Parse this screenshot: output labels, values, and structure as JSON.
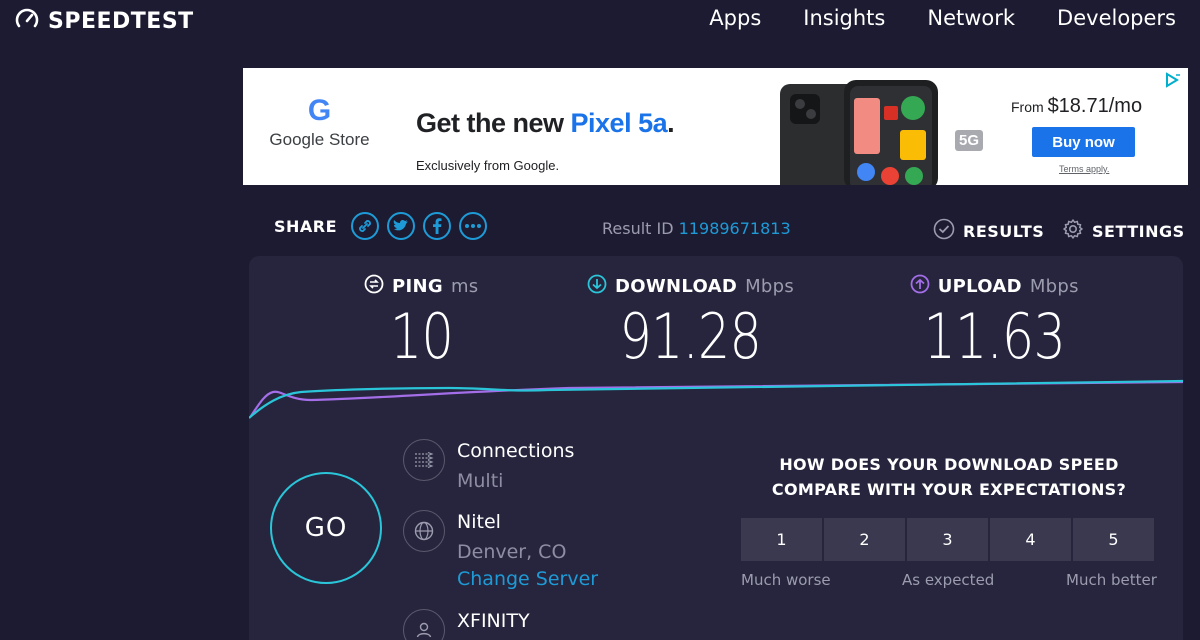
{
  "header": {
    "logo_text": "SPEEDTEST",
    "nav": [
      "Apps",
      "Insights",
      "Network",
      "Developers"
    ]
  },
  "ad": {
    "brand_logo": "G",
    "brand_name": "Google Store",
    "headline_pre": "Get the new ",
    "headline_product": "Pixel 5a",
    "headline_post": ".",
    "subline": "Exclusively from Google.",
    "badge": "5G",
    "price_from": "From ",
    "price": "$18.71/mo",
    "cta": "Buy now",
    "terms": "Terms apply.",
    "colors": {
      "blue": "#1a73e8",
      "gray_badge": "#a8aab0"
    }
  },
  "share": {
    "label": "SHARE",
    "icons": [
      "link-icon",
      "twitter-icon",
      "facebook-icon",
      "more-icon"
    ]
  },
  "result": {
    "label": "Result ID ",
    "id": "11989671813"
  },
  "actions": {
    "results": "RESULTS",
    "settings": "SETTINGS"
  },
  "metrics": {
    "ping": {
      "label": "PING",
      "unit": "ms",
      "value": "10"
    },
    "download": {
      "label": "DOWNLOAD",
      "unit": "Mbps",
      "value": "91.28"
    },
    "upload": {
      "label": "UPLOAD",
      "unit": "Mbps",
      "value": "11.63"
    }
  },
  "go_label": "GO",
  "connections": {
    "label": "Connections",
    "value": "Multi"
  },
  "server": {
    "name": "Nitel",
    "location": "Denver, CO",
    "change_link": "Change Server"
  },
  "isp": {
    "name": "XFINITY"
  },
  "survey": {
    "question": "HOW DOES YOUR DOWNLOAD SPEED COMPARE WITH YOUR EXPECTATIONS?",
    "options": [
      "1",
      "2",
      "3",
      "4",
      "5"
    ],
    "labels": {
      "low": "Much worse",
      "mid": "As expected",
      "high": "Much better"
    }
  },
  "colors": {
    "background": "#1c1b31",
    "panel": "#26253d",
    "accent_cyan": "#2ac5d8",
    "accent_purple": "#a36ee8",
    "link_blue": "#1e9bd7"
  }
}
